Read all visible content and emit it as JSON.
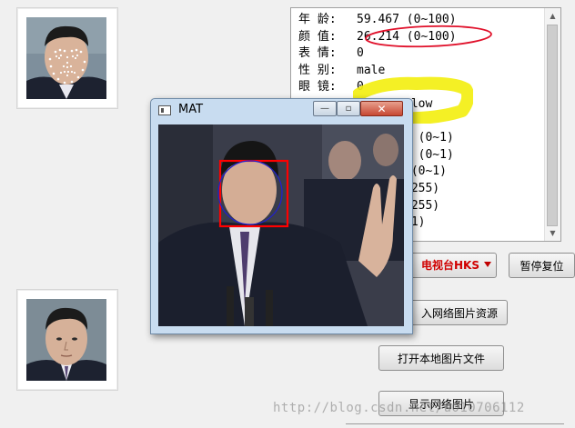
{
  "info_panel": {
    "lines": [
      {
        "key": "年  龄:",
        "value": "59.467 (0~100)"
      },
      {
        "key": "颜  值:",
        "value": "26.214 (0~100)"
      },
      {
        "key": "表  情:",
        "value": "0"
      },
      {
        "key": "性  别:",
        "value": "male"
      },
      {
        "key": "眼  镜:",
        "value": "0"
      },
      {
        "key": "",
        "value": "llow"
      },
      {
        "key": "",
        "value": ""
      },
      {
        "key": "",
        "value": "0 (0~1)"
      },
      {
        "key": "",
        "value": "0 (0~1)"
      },
      {
        "key": "",
        "value": "0(0~1)"
      },
      {
        "key": "",
        "value": "~255)"
      },
      {
        "key": "",
        "value": "~255)"
      },
      {
        "key": "",
        "value": "/1)"
      }
    ]
  },
  "channel_combo": {
    "value": "电视台HKS"
  },
  "buttons": {
    "pause_reset": "暂停复位",
    "network_resource": "入网络图片资源",
    "open_local": "打开本地图片文件",
    "show_network": "显示网络图片"
  },
  "mat_window": {
    "title": "MAT",
    "minimize_glyph": "—",
    "maximize_glyph": "▫",
    "close_glyph": "✕"
  },
  "watermark": "http://blog.csdn.net/u010706112",
  "colors": {
    "red_ellipse": "#e0102a",
    "yellow_highlight": "#f3ef12",
    "combo_text": "#d00000",
    "face_box": "#ff0000",
    "face_circle": "#2020d0"
  },
  "icons": {
    "mat_app": "window-app-icon",
    "scroll_up": "arrow-up-icon",
    "scroll_down": "arrow-down-icon",
    "combo": "chevron-down-icon"
  }
}
